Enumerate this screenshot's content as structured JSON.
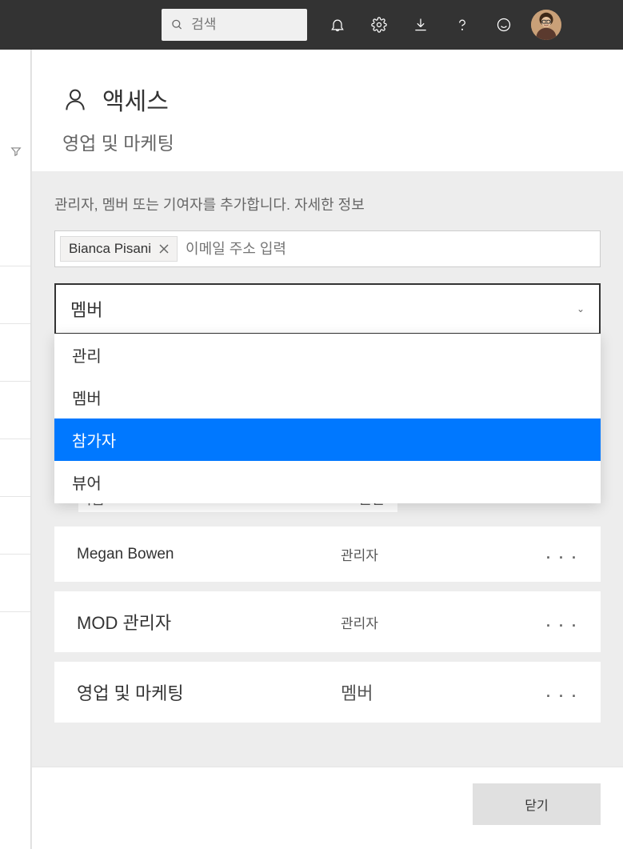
{
  "topbar": {
    "search_placeholder": "검색"
  },
  "panel": {
    "title": "액세스",
    "subtitle": "영업 및 마케팅",
    "help_text": "관리자, 멤버 또는 기여자를 추가합니다. 자세한 정보",
    "chip_name": "Bianca Pisani",
    "email_placeholder": "이메일 주소 입력"
  },
  "dropdown": {
    "selected": "멤버",
    "options": [
      "관리",
      "멤버",
      "참가자",
      "뷰어"
    ],
    "highlighted_index": 2
  },
  "table": {
    "col_name": "이름",
    "col_perm": "권한"
  },
  "rows": [
    {
      "name": "Megan Bowen",
      "role": "관리자",
      "big": false
    },
    {
      "name": "MOD 관리자",
      "role": "관리자",
      "big": true
    },
    {
      "name": "영업 및 마케팅",
      "role": "멤버",
      "big": true,
      "big_role": true
    }
  ],
  "footer": {
    "close": "닫기"
  }
}
